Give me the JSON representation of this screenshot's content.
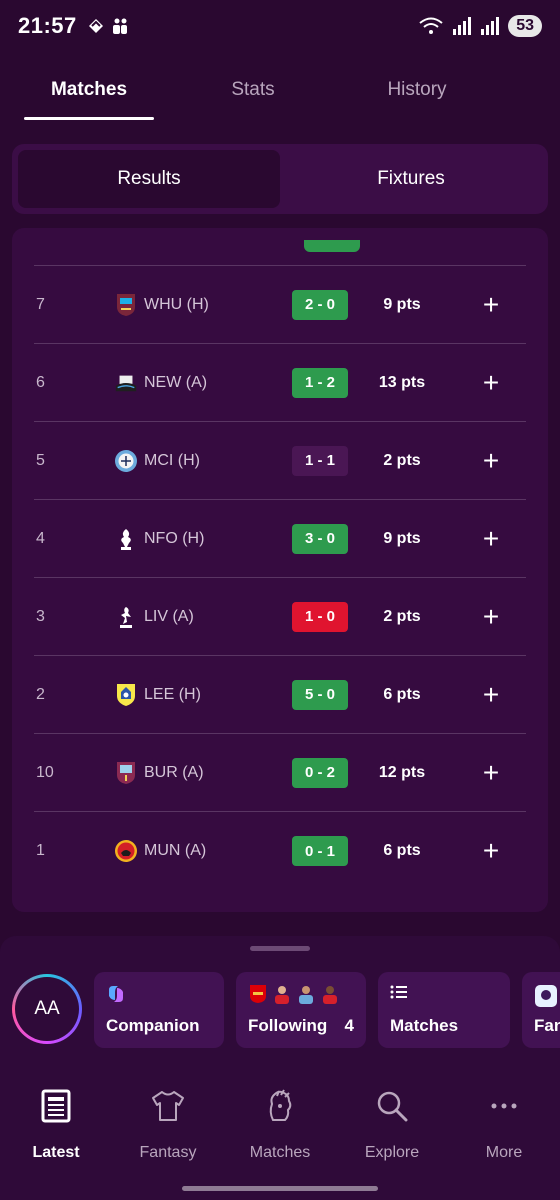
{
  "status_bar": {
    "time": "21:57",
    "battery": "53"
  },
  "tabs": [
    {
      "label": "Matches",
      "active": true
    },
    {
      "label": "Stats",
      "active": false
    },
    {
      "label": "History",
      "active": false
    }
  ],
  "segments": [
    {
      "label": "Results",
      "active": true
    },
    {
      "label": "Fixtures",
      "active": false
    }
  ],
  "colors": {
    "win": "#2e9b4e",
    "draw": "#4a1654",
    "loss": "#e0142f",
    "background": "#2a0830"
  },
  "rows": [
    {
      "gw": "7",
      "team": "WHU (H)",
      "crest": "west-ham-crest-icon",
      "score": "2 - 0",
      "result": "win",
      "pts": "9 pts",
      "expand": "+"
    },
    {
      "gw": "6",
      "team": "NEW (A)",
      "crest": "newcastle-crest-icon",
      "score": "1 - 2",
      "result": "win",
      "pts": "13 pts",
      "expand": "+"
    },
    {
      "gw": "5",
      "team": "MCI (H)",
      "crest": "man-city-crest-icon",
      "score": "1 - 1",
      "result": "draw",
      "pts": "2 pts",
      "expand": "+"
    },
    {
      "gw": "4",
      "team": "NFO (H)",
      "crest": "nottingham-forest-crest-icon",
      "score": "3 - 0",
      "result": "win",
      "pts": "9 pts",
      "expand": "+"
    },
    {
      "gw": "3",
      "team": "LIV (A)",
      "crest": "liverpool-crest-icon",
      "score": "1 - 0",
      "result": "loss",
      "pts": "2 pts",
      "expand": "+"
    },
    {
      "gw": "2",
      "team": "LEE (H)",
      "crest": "leeds-crest-icon",
      "score": "5 - 0",
      "result": "win",
      "pts": "6 pts",
      "expand": "+"
    },
    {
      "gw": "10",
      "team": "BUR (A)",
      "crest": "burnley-crest-icon",
      "score": "0 - 2",
      "result": "win",
      "pts": "12 pts",
      "expand": "+"
    },
    {
      "gw": "1",
      "team": "MUN (A)",
      "crest": "man-utd-crest-icon",
      "score": "0 - 1",
      "result": "win",
      "pts": "6 pts",
      "expand": "+"
    }
  ],
  "sheet": {
    "avatar_initials": "AA",
    "quick_links": [
      {
        "label": "Companion"
      },
      {
        "label": "Following",
        "count": "4"
      },
      {
        "label": "Matches"
      },
      {
        "label": "Fan"
      }
    ]
  },
  "bottom_nav": [
    {
      "label": "Latest",
      "active": true
    },
    {
      "label": "Fantasy",
      "active": false
    },
    {
      "label": "Matches",
      "active": false
    },
    {
      "label": "Explore",
      "active": false
    },
    {
      "label": "More",
      "active": false
    }
  ]
}
